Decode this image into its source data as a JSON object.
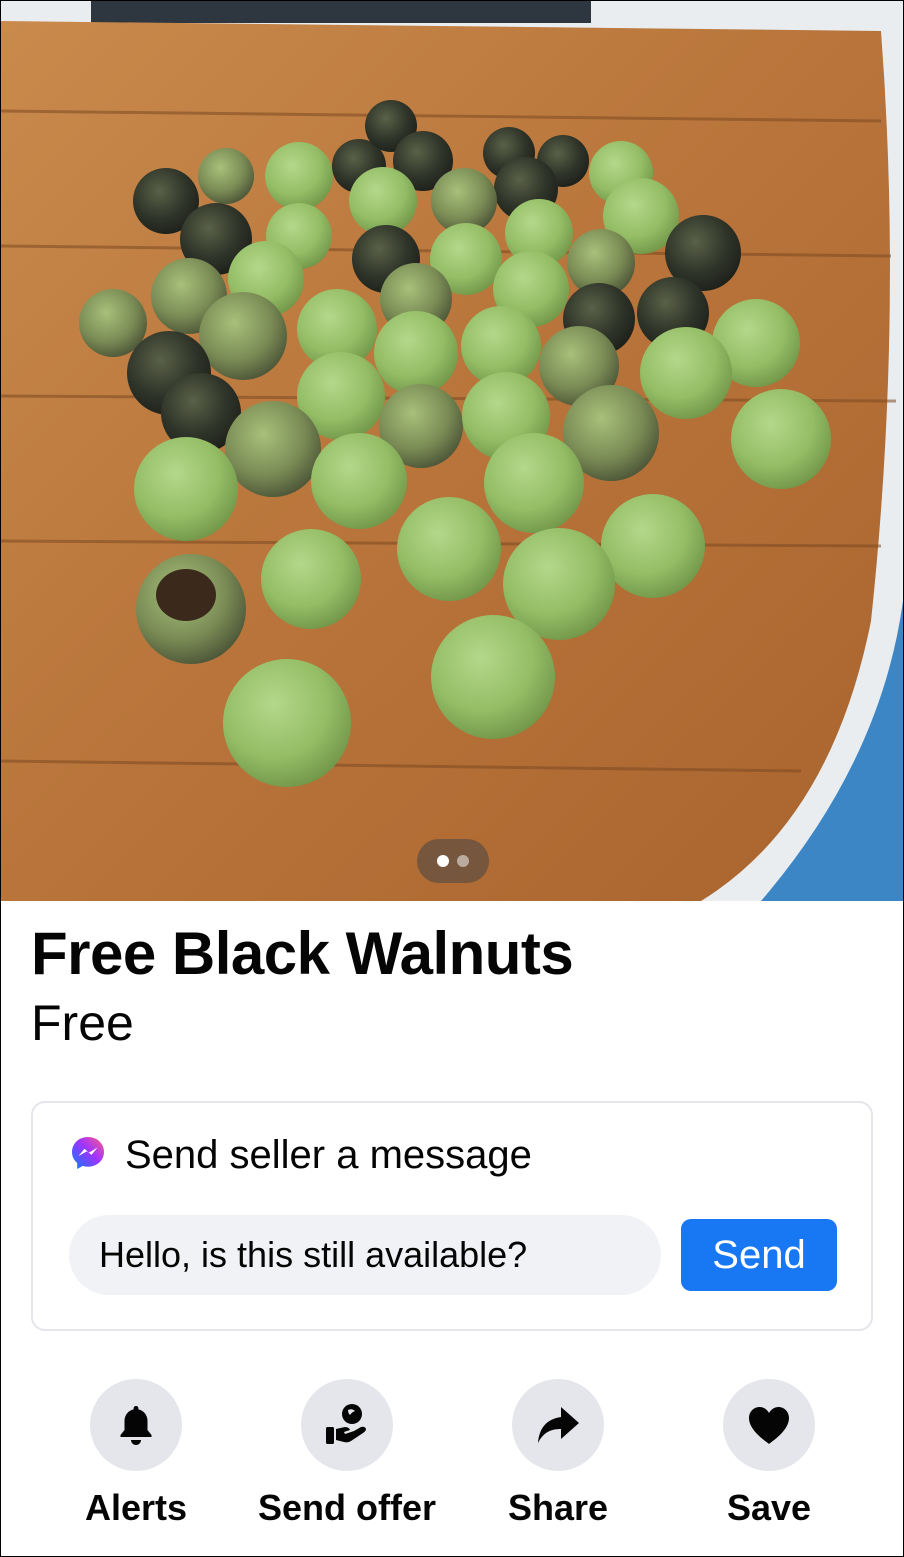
{
  "listing": {
    "title": "Free Black Walnuts",
    "price": "Free",
    "photo_count": 2,
    "current_photo": 1
  },
  "message": {
    "header": "Send seller a message",
    "input_value": "Hello, is this still available?",
    "send_label": "Send"
  },
  "actions": [
    {
      "label": "Alerts",
      "icon": "bell-icon"
    },
    {
      "label": "Send offer",
      "icon": "offer-hand-icon"
    },
    {
      "label": "Share",
      "icon": "share-arrow-icon"
    },
    {
      "label": "Save",
      "icon": "heart-icon"
    }
  ],
  "colors": {
    "accent": "#1877f2",
    "text": "#050505",
    "button_bg": "#e4e6eb",
    "input_bg": "#f0f2f5"
  }
}
